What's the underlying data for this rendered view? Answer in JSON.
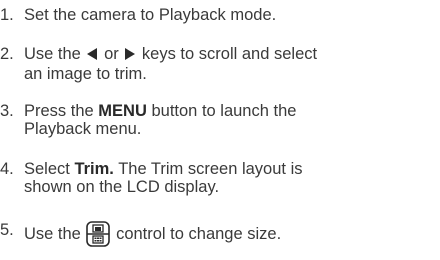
{
  "cut_text": "",
  "steps": [
    {
      "number": "1.",
      "text": "Set the camera to Playback mode."
    },
    {
      "number": "2.",
      "text_before": "Use the",
      "text_mid": "or",
      "text_after": "keys to scroll and select",
      "text_line2": "an image to trim.",
      "icons": [
        "left-arrow-icon",
        "right-arrow-icon"
      ]
    },
    {
      "number": "3.",
      "text_before": "Press the",
      "bold": "MENU",
      "text_after": "button to launch the",
      "text_line2": "Playback menu."
    },
    {
      "number": "4.",
      "text_before": "Select",
      "bold": "Trim.",
      "text_after": "The Trim screen layout is",
      "text_line2": "shown on the LCD display."
    },
    {
      "number": "5.",
      "text_before": "Use the",
      "text_after": "control to change size.",
      "icons": [
        "zoom-control-icon"
      ]
    }
  ]
}
